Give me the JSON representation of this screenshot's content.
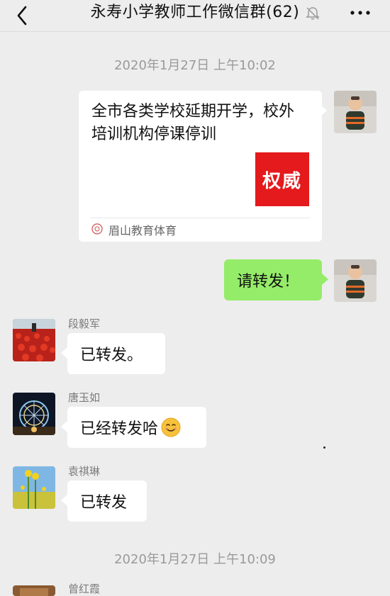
{
  "header": {
    "title": "永寿小学教师工作微信群(62)",
    "back_icon": "chevron-left-icon",
    "mute_icon": "bell-muted-icon",
    "more_icon": "ellipsis-icon"
  },
  "timestamps": [
    "2020年1月27日 上午10:02",
    "2020年1月27日 上午10:09"
  ],
  "messages": [
    {
      "type": "link_card",
      "side": "right",
      "title": "全市各类学校延期开学，校外培训机构停课停训",
      "thumbnail_text": "权威",
      "source": "眉山教育体育",
      "avatar": "toddler-photo"
    },
    {
      "type": "text",
      "side": "right",
      "text": "请转发！",
      "avatar": "toddler-photo"
    },
    {
      "type": "text",
      "side": "left",
      "sender": "段毅军",
      "text": "已转发。",
      "avatar": "red-tulips-photo"
    },
    {
      "type": "text",
      "side": "left",
      "sender": "唐玉如",
      "text": "已经转发哈",
      "emoji": "smiling-face-emoji",
      "avatar": "ferris-wheel-night-photo"
    },
    {
      "type": "text",
      "side": "left",
      "sender": "袁祺琳",
      "text": "已转发",
      "avatar": "yellow-flowers-photo"
    },
    {
      "type": "text",
      "side": "left",
      "sender": "曾红霞",
      "avatar": "brown-photo"
    }
  ],
  "colors": {
    "background": "#ededed",
    "bubble_self": "#95ec69",
    "bubble_other": "#ffffff",
    "timestamp": "#9a9a9a",
    "thumbnail": "#e41a1c"
  }
}
